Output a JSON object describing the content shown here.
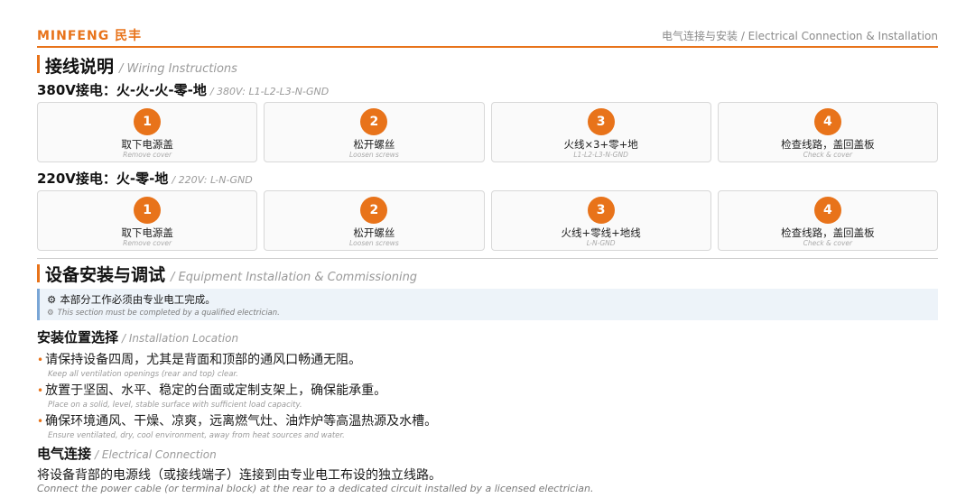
{
  "header": {
    "brand": "MINFENG 民丰",
    "title": "电气连接与安装 / Electrical Connection & Installation"
  },
  "wiring": {
    "title": "接线说明",
    "subtitle": "/ Wiring Instructions",
    "v380": {
      "title": "380V接电：火-火-火-零-地",
      "subtitle": "/ 380V: L1-L2-L3-N-GND",
      "steps": [
        {
          "num": "1",
          "cn": "取下电源盖",
          "en": "Remove cover"
        },
        {
          "num": "2",
          "cn": "松开螺丝",
          "en": "Loosen screws"
        },
        {
          "num": "3",
          "cn": "火线×3+零+地",
          "en": "L1-L2-L3-N-GND"
        },
        {
          "num": "4",
          "cn": "检查线路，盖回盖板",
          "en": "Check & cover"
        }
      ]
    },
    "v220": {
      "title": "220V接电：火-零-地",
      "subtitle": "/ 220V: L-N-GND",
      "steps": [
        {
          "num": "1",
          "cn": "取下电源盖",
          "en": "Remove cover"
        },
        {
          "num": "2",
          "cn": "松开螺丝",
          "en": "Loosen screws"
        },
        {
          "num": "3",
          "cn": "火线+零线+地线",
          "en": "L-N-GND"
        },
        {
          "num": "4",
          "cn": "检查线路，盖回盖板",
          "en": "Check & cover"
        }
      ]
    }
  },
  "install": {
    "title": "设备安装与调试",
    "subtitle": "/ Equipment Installation & Commissioning",
    "notice": {
      "icon": "gear-icon",
      "cn": "本部分工作必须由专业电工完成。",
      "en": "This section must be completed by a qualified electrician."
    },
    "location": {
      "title": "安装位置选择",
      "subtitle": "/ Installation Location",
      "items": [
        {
          "cn": "请保持设备四周，尤其是背面和顶部的通风口畅通无阻。",
          "en": "Keep all ventilation openings (rear and top) clear."
        },
        {
          "cn": "放置于坚固、水平、稳定的台面或定制支架上，确保能承重。",
          "en": "Place on a solid, level, stable surface with sufficient load capacity."
        },
        {
          "cn": "确保环境通风、干燥、凉爽，远离燃气灶、油炸炉等高温热源及水槽。",
          "en": "Ensure ventilated, dry, cool environment, away from heat sources and water."
        }
      ]
    },
    "electrical": {
      "title": "电气连接",
      "subtitle": "/ Electrical Connection",
      "cn": "将设备背部的电源线（或接线端子）连接到由专业电工布设的独立线路。",
      "en": "Connect the power cable (or terminal block) at the rear to a dedicated circuit installed by a licensed electrician."
    }
  },
  "colors": {
    "accent": "#e8731a",
    "notice_bg": "#edf3f9",
    "notice_border": "#7aa6d6"
  }
}
